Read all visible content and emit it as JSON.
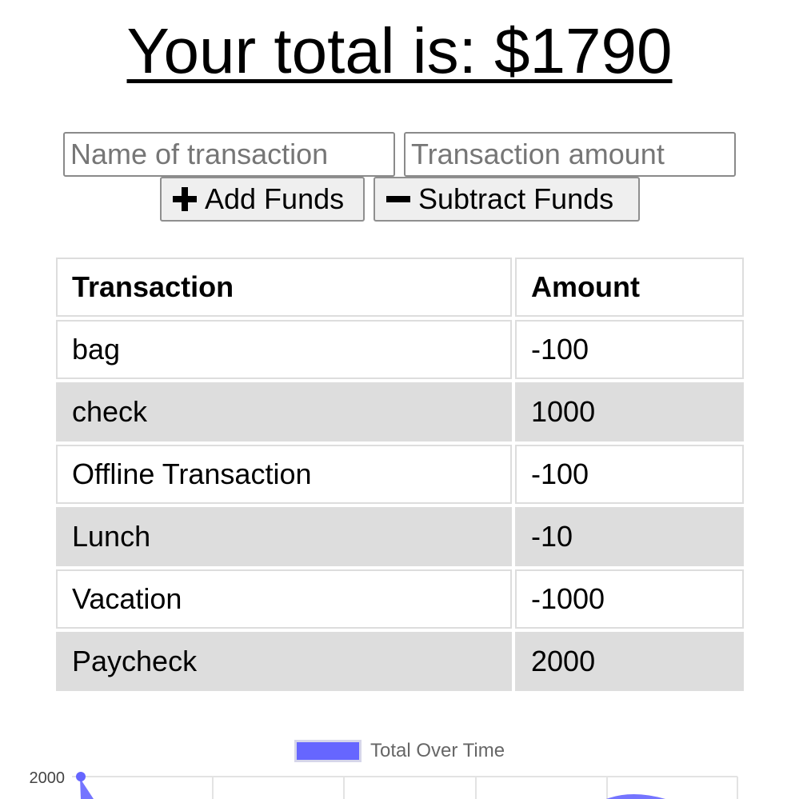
{
  "header": {
    "total_prefix": "Your total is: $",
    "total_value": "1790"
  },
  "form": {
    "name_placeholder": "Name of transaction",
    "amount_placeholder": "Transaction amount",
    "add_label": "Add Funds",
    "subtract_label": "Subtract Funds"
  },
  "icons": {
    "add": "plus-icon",
    "subtract": "minus-icon"
  },
  "table": {
    "headers": [
      "Transaction",
      "Amount"
    ],
    "rows": [
      {
        "name": "bag",
        "amount": "-100"
      },
      {
        "name": "check",
        "amount": "1000"
      },
      {
        "name": "Offline Transaction",
        "amount": "-100"
      },
      {
        "name": "Lunch",
        "amount": "-10"
      },
      {
        "name": "Vacation",
        "amount": "-1000"
      },
      {
        "name": "Paycheck",
        "amount": "2000"
      }
    ]
  },
  "chart_data": {
    "type": "line",
    "legend": [
      "Total Over Time"
    ],
    "series": [
      {
        "name": "Total Over Time",
        "color": "#6666ff"
      }
    ],
    "visible_y_ticks": [
      "2000"
    ],
    "grid": true
  },
  "colors": {
    "series_fill": "#6666ff",
    "stripe": "#dddddd",
    "border": "#dddddd"
  }
}
